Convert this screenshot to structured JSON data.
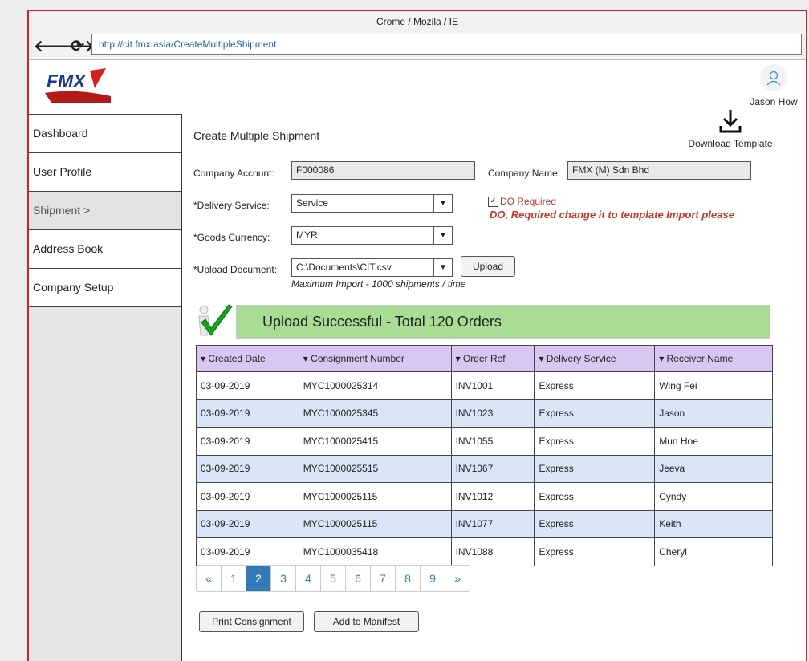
{
  "browser": {
    "title": "Crome / Mozila / IE",
    "url": "http://cit.fmx.asia/CreateMultipleShipment",
    "nav_back": "🡐",
    "nav_forward": "🡒",
    "nav_reload": "⟳"
  },
  "header": {
    "logo_text": "FMX",
    "user_name": "Jason How"
  },
  "sidebar": {
    "items": [
      {
        "label": "Dashboard"
      },
      {
        "label": "User Profile"
      },
      {
        "label": "Shipment >"
      },
      {
        "label": "Address Book"
      },
      {
        "label": "Company Setup"
      }
    ]
  },
  "main": {
    "title": "Create Multiple Shipment",
    "download_label": "Download Template",
    "company_account_label": "Company Account:",
    "company_account_value": "F000086",
    "company_name_label": "Company Name:",
    "company_name_value": "FMX (M) Sdn Bhd",
    "delivery_service_label": "*Delivery Service:",
    "delivery_service_value": "Service",
    "goods_currency_label": "*Goods Currency:",
    "goods_currency_value": "MYR",
    "upload_document_label": "*Upload Document:",
    "upload_document_value": "C:\\Documents\\CIT.csv",
    "upload_button": "Upload",
    "do_required_label": "DO Required",
    "do_required_checked": true,
    "do_note": "DO, Required change it to template Import please",
    "max_import_hint": "Maximum Import - 1000 shipments / time",
    "success_message": "Upload Successful - Total 120 Orders"
  },
  "table": {
    "columns": [
      "▾ Created Date",
      "▾ Consignment Number",
      "▾ Order Ref",
      "▾ Delivery Service",
      "▾ Receiver Name"
    ],
    "rows": [
      [
        "03-09-2019",
        "MYC1000025314",
        "INV1001",
        "Express",
        "Wing Fei"
      ],
      [
        "03-09-2019",
        "MYC1000025345",
        "INV1023",
        "Express",
        "Jason"
      ],
      [
        "03-09-2019",
        "MYC1000025415",
        "INV1055",
        "Express",
        "Mun Hoe"
      ],
      [
        "03-09-2019",
        "MYC1000025515",
        "INV1067",
        "Express",
        "Jeeva"
      ],
      [
        "03-09-2019",
        "MYC1000025115",
        "INV1012",
        "Express",
        "Cyndy"
      ],
      [
        "03-09-2019",
        "MYC1000025115",
        "INV1077",
        "Express",
        "Keith"
      ],
      [
        "03-09-2019",
        "MYC1000035418",
        "INV1088",
        "Express",
        "Cheryl"
      ]
    ]
  },
  "pagination": {
    "pages": [
      "«",
      "1",
      "2",
      "3",
      "4",
      "5",
      "6",
      "7",
      "8",
      "9",
      "»"
    ],
    "current": "2"
  },
  "actions": {
    "print_label": "Print Consignment",
    "manifest_label": "Add to Manifest"
  },
  "colors": {
    "frame_border": "#d0202a",
    "success_bg": "#a9dc94",
    "table_header_bg": "#d9c6f3",
    "table_alt_row": "#d8e6f7",
    "pager_active": "#337ab7",
    "warning_text": "#c0392b"
  }
}
